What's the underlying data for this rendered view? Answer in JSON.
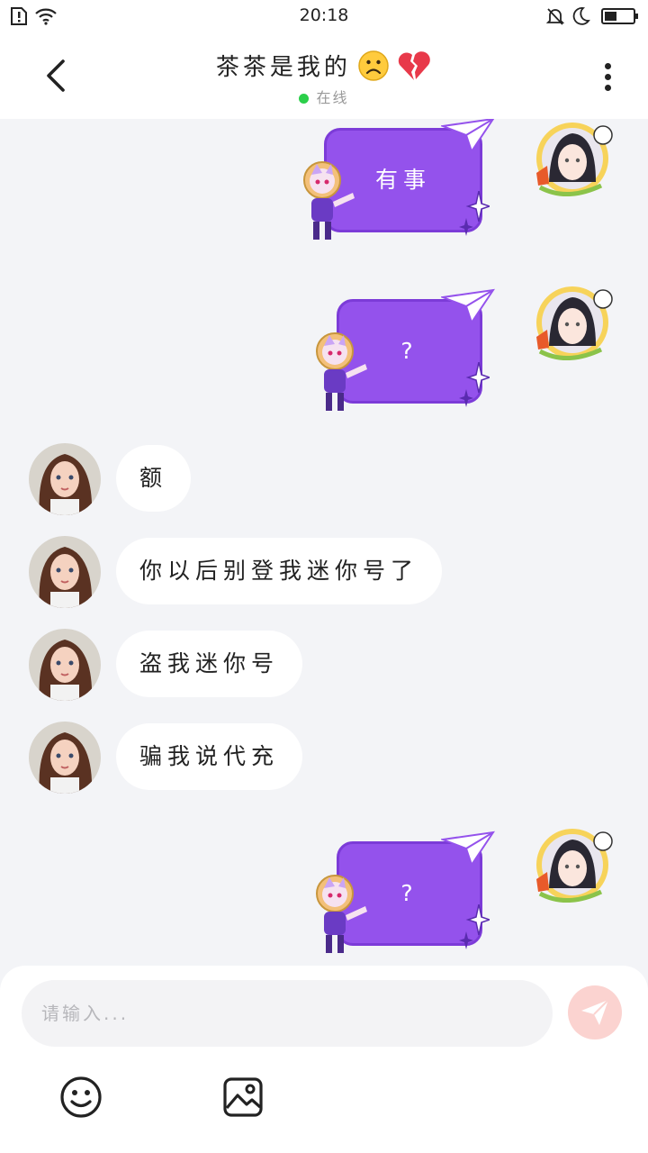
{
  "status_bar": {
    "time": "20:18"
  },
  "header": {
    "title": "茶茶是我的",
    "emoji": [
      "sad-face",
      "broken-heart"
    ],
    "status": "在线",
    "status_color": "#2bcf4a"
  },
  "messages": [
    {
      "side": "right",
      "text": "有事"
    },
    {
      "side": "right",
      "text": "?"
    },
    {
      "side": "left",
      "text": "额"
    },
    {
      "side": "left",
      "text": "你以后别登我迷你号了"
    },
    {
      "side": "left",
      "text": "盗我迷你号"
    },
    {
      "side": "left",
      "text": "骗我说代充"
    },
    {
      "side": "right",
      "text": "?"
    }
  ],
  "composer": {
    "placeholder": "请输入...",
    "value": "",
    "send_color": "#fbd3d0",
    "tools": [
      "emoji-icon",
      "image-icon"
    ]
  },
  "colors": {
    "bubble_out": "#9452ec",
    "bubble_in": "#ffffff",
    "background": "#f3f4f7"
  }
}
